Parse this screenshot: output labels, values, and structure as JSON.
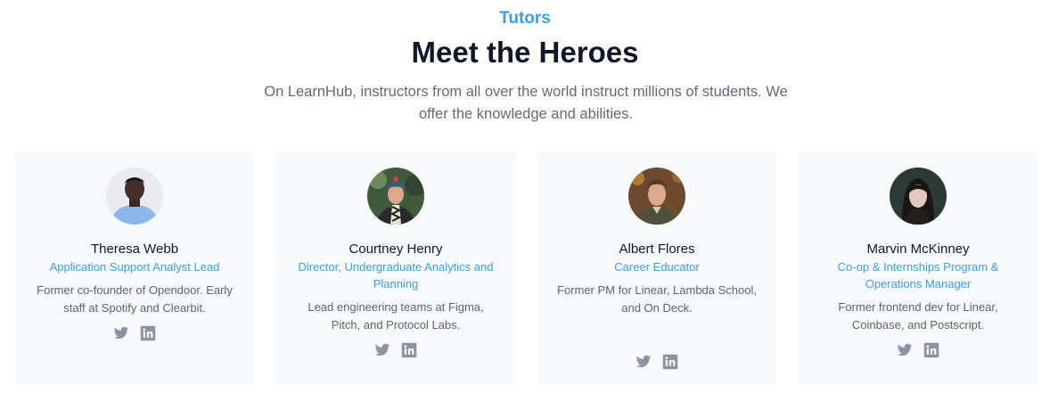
{
  "section": {
    "eyebrow": "Tutors",
    "title": "Meet the Heroes",
    "subtitle": "On LearnHub, instructors from all over the world instruct millions of students. We offer the knowledge and abilities."
  },
  "colors": {
    "accent": "#3b9fe6",
    "heading": "#101828",
    "muted": "#5f6b7a",
    "card_bg": "#f8f9fb",
    "icon": "#8a94a3"
  },
  "tutors": [
    {
      "name": "Theresa Webb",
      "role": "Application Support Analyst Lead",
      "bio": "Former co-founder of Opendoor. Early staff at Spotify and Clearbit.",
      "socials": [
        "twitter-icon",
        "linkedin-icon"
      ]
    },
    {
      "name": "Courtney Henry",
      "role": "Director, Undergraduate Analytics and Planning",
      "bio": "Lead engineering teams at Figma, Pitch, and Protocol Labs.",
      "socials": [
        "twitter-icon",
        "linkedin-icon"
      ]
    },
    {
      "name": "Albert Flores",
      "role": "Career Educator",
      "bio": "Former PM for Linear, Lambda School, and On Deck.",
      "socials": [
        "twitter-icon",
        "linkedin-icon"
      ]
    },
    {
      "name": "Marvin McKinney",
      "role": "Co-op & Internships Program & Operations Manager",
      "bio": "Former frontend dev for Linear, Coinbase, and Postscript.",
      "socials": [
        "twitter-icon",
        "linkedin-icon"
      ]
    }
  ]
}
